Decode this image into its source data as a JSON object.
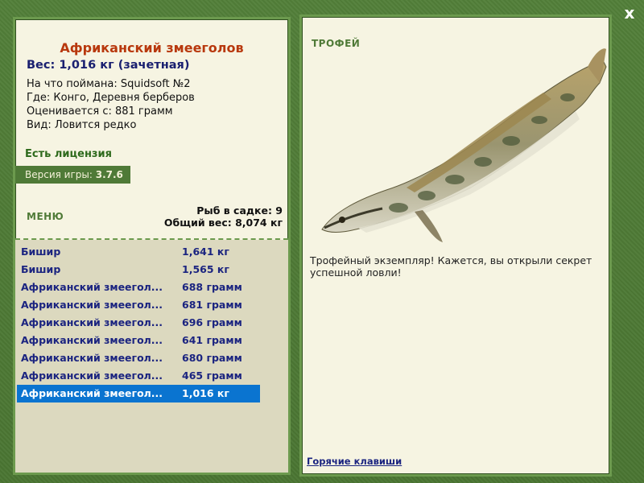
{
  "close_label": "x",
  "fish": {
    "title": "Африканский змееголов",
    "weight_line": "Вес: 1,016 кг (зачетная)",
    "info": [
      "На что поймана: Squidsoft №2",
      "Где: Конго, Деревня берберов",
      "Оценивается с: 881 грамм",
      "Вид: Ловится редко"
    ]
  },
  "license_text": "Есть лицензия",
  "version": {
    "label": "Версия игры:",
    "value": "3.7.6"
  },
  "menu_label": "МЕНЮ",
  "keep": {
    "count_text": "Рыб в садке: 9",
    "total_text": "Общий вес: 8,074 кг"
  },
  "catch_list": [
    {
      "name": "Бишир",
      "weight": "1,641 кг"
    },
    {
      "name": "Бишир",
      "weight": "1,565 кг"
    },
    {
      "name": "Африканский змеегол...",
      "weight": "688 грамм"
    },
    {
      "name": "Африканский змеегол...",
      "weight": "681 грамм"
    },
    {
      "name": "Африканский змеегол...",
      "weight": "696 грамм"
    },
    {
      "name": "Африканский змеегол...",
      "weight": "641 грамм"
    },
    {
      "name": "Африканский змеегол...",
      "weight": "680 грамм"
    },
    {
      "name": "Африканский змеегол...",
      "weight": "465 грамм"
    },
    {
      "name": "Африканский змеегол...",
      "weight": "1,016 кг",
      "selected": true
    }
  ],
  "trophy": {
    "title": "ТРОФЕЙ",
    "text": "Трофейный экземпляр! Кажется, вы открыли секрет успешной ловли!"
  },
  "hotkeys_label": "Горячие клавиши",
  "colors": {
    "background": "#4d7a35",
    "panel": "#f6f4e2",
    "title_red": "#b8380d",
    "text_navy": "#1b2480",
    "accent_green": "#4f7a37",
    "selection_blue": "#0a74d0"
  }
}
